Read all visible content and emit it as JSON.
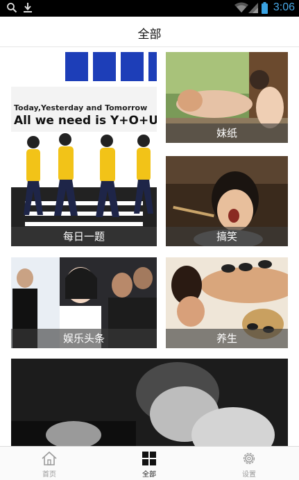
{
  "status_bar": {
    "time": "3:06",
    "icons": [
      "search-icon",
      "download-icon",
      "wifi-icon",
      "signal-icon",
      "battery-icon"
    ]
  },
  "header": {
    "title": "全部"
  },
  "tiles": [
    {
      "label": "每日一题",
      "image_text_line1": "Today,Yesterday and Tomorrow",
      "image_text_line2": "All we need is Y+O+U"
    },
    {
      "label": "妹纸"
    },
    {
      "label": "搞笑"
    },
    {
      "label": "娱乐头条"
    },
    {
      "label": "养生"
    }
  ],
  "bottom_nav": {
    "items": [
      {
        "label": "首页",
        "icon": "home-icon",
        "active": false
      },
      {
        "label": "全部",
        "icon": "grid-icon",
        "active": true
      },
      {
        "label": "设置",
        "icon": "gear-icon",
        "active": false
      }
    ]
  },
  "colors": {
    "accent": "#3aa3e3",
    "label_overlay": "#3c3c3c",
    "status_bar": "#000000"
  }
}
